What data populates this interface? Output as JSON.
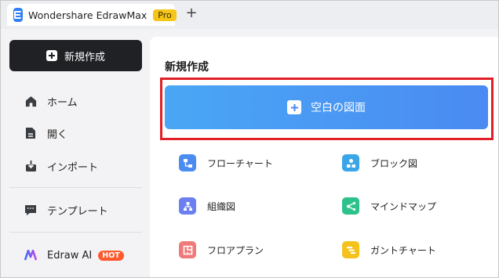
{
  "titlebar": {
    "app_title": "Wondershare EdrawMax",
    "pro_badge": "Pro",
    "new_tab": "+"
  },
  "sidebar": {
    "new_button": "新規作成",
    "items": [
      {
        "label": "ホーム",
        "icon": "home-icon"
      },
      {
        "label": "開く",
        "icon": "file-icon"
      },
      {
        "label": "インポート",
        "icon": "import-icon"
      },
      {
        "label": "テンプレート",
        "icon": "template-icon"
      },
      {
        "label": "Edraw AI",
        "icon": "edraw-ai-icon",
        "badge": "HOT"
      }
    ]
  },
  "main": {
    "section_title": "新規作成",
    "blank_button": "空白の図面",
    "tiles": [
      {
        "label": "フローチャート",
        "icon": "flowchart-icon",
        "color": "#4a8cf0"
      },
      {
        "label": "ブロック図",
        "icon": "block-diagram-icon",
        "color": "#3aa6e8"
      },
      {
        "label": "組織図",
        "icon": "org-chart-icon",
        "color": "#6c7ff0"
      },
      {
        "label": "マインドマップ",
        "icon": "mind-map-icon",
        "color": "#2cc28a"
      },
      {
        "label": "フロアプラン",
        "icon": "floor-plan-icon",
        "color": "#f07a7a"
      },
      {
        "label": "ガントチャート",
        "icon": "gantt-chart-icon",
        "color": "#f5c21b"
      }
    ]
  },
  "colors": {
    "accent": "#4a8af2",
    "highlight": "#e01f26",
    "hot": "#ff5a2e",
    "pro": "#f5c518"
  }
}
